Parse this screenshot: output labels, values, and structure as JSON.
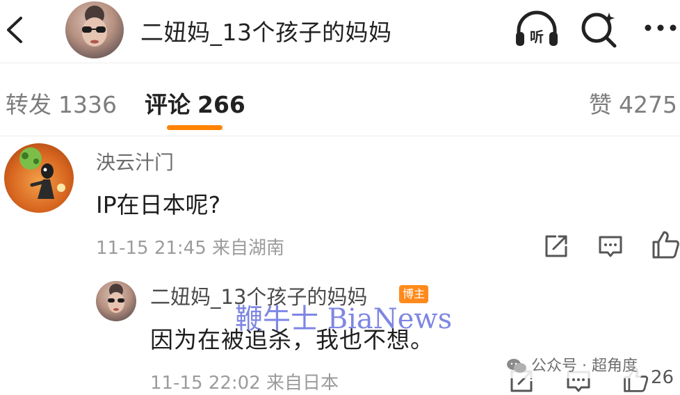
{
  "header": {
    "title": "二妞妈_13个孩子的妈妈",
    "listen_label": "听"
  },
  "tabs": [
    {
      "label": "转发",
      "count": "1336"
    },
    {
      "label": "评论",
      "count": "266"
    },
    {
      "label": "赞",
      "count": "4275"
    }
  ],
  "comments": [
    {
      "name": "泱云汁门",
      "text": "IP在日本呢?",
      "meta": "11-15 21:45 来自湖南"
    }
  ],
  "reply": {
    "name": "二妞妈_13个孩子的妈妈",
    "badge": "博主",
    "text": "因为在被追杀，我也不想。",
    "meta": "11-15 22:02 来自日本",
    "like_count": "26"
  },
  "watermarks": {
    "main": "鞭牛士 BiaNews",
    "wechat": "公众号 · 超角度"
  },
  "colors": {
    "accent": "#ff8200",
    "badge": "#ff8a1c",
    "watermark": "#5a64dc"
  }
}
